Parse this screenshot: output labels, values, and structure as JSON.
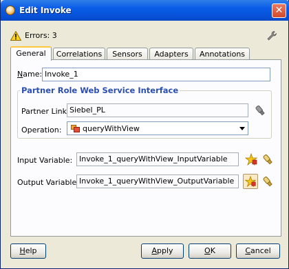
{
  "window": {
    "title": "Edit Invoke"
  },
  "status": {
    "errors_label": "Errors: 3"
  },
  "tabs": [
    {
      "label": "General",
      "active": true
    },
    {
      "label": "Correlations",
      "active": false
    },
    {
      "label": "Sensors",
      "active": false
    },
    {
      "label": "Adapters",
      "active": false
    },
    {
      "label": "Annotations",
      "active": false
    }
  ],
  "general": {
    "name_label": "Name:",
    "name_label_mnemonic": "N",
    "name_value": "Invoke_1",
    "group_title": "Partner Role Web Service Interface",
    "partner_link_label": "Partner Link:",
    "partner_link_value": "Siebel_PL",
    "operation_label": "Operation:",
    "operation_value": "queryWithView",
    "input_variable_label": "Input Variable:",
    "input_variable_value": "Invoke_1_queryWithView_InputVariable",
    "output_variable_label": "Output Variable:",
    "output_variable_value": "Invoke_1_queryWithView_OutputVariable"
  },
  "buttons": {
    "help": {
      "mnemonic": "H",
      "rest": "elp"
    },
    "apply": {
      "mnemonic": "A",
      "rest": "pply"
    },
    "ok": {
      "mnemonic": "O",
      "rest": "K"
    },
    "cancel": {
      "mnemonic": "C",
      "rest": "ancel"
    }
  },
  "colors": {
    "titlebar": "#0a5ce8",
    "group_title": "#2a4fb0",
    "active_tab_highlight": "#ffc83c",
    "dialog_bg": "#ece9d8"
  },
  "icons": {
    "title": "oracle-bpel-icon",
    "errors": "warning-triangle-icon",
    "settings": "wrench-icon",
    "partner_link_browse": "flashlight-icon",
    "operation": "operation-icon",
    "create_variable": "create-variable-icon",
    "browse_variable": "flashlight-icon"
  }
}
